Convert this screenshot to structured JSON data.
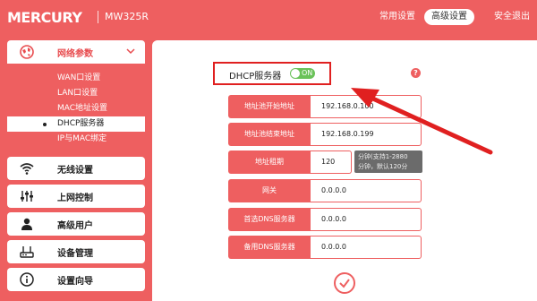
{
  "header": {
    "logo": "MERCURY",
    "model": "MW325R",
    "nav": [
      "常用设置",
      "高级设置",
      "安全退出"
    ]
  },
  "sidebar": {
    "network": {
      "label": "网络参数",
      "items": [
        "WAN口设置",
        "LAN口设置",
        "MAC地址设置",
        "DHCP服务器",
        "IP与MAC绑定"
      ]
    },
    "cards": [
      "无线设置",
      "上网控制",
      "高级用户",
      "设备管理",
      "设置向导"
    ]
  },
  "main": {
    "dhcp_label": "DHCP服务器",
    "toggle_text": "ON",
    "help": "?",
    "fields": [
      {
        "key": "地址池开始地址",
        "value": "192.168.0.100"
      },
      {
        "key": "地址池结束地址",
        "value": "192.168.0.199"
      },
      {
        "key": "地址租期",
        "value": "120"
      },
      {
        "key": "网关",
        "value": "0.0.0.0"
      },
      {
        "key": "首选DNS服务器",
        "value": "0.0.0.0"
      },
      {
        "key": "备用DNS服务器",
        "value": "0.0.0.0"
      }
    ],
    "tip_line1": "分钟(支持1-2880",
    "tip_line2": "分钟，默认120分"
  },
  "colors": {
    "accent": "#ee5f60",
    "toggle_on": "#6ac259",
    "highlight": "#e02020"
  }
}
